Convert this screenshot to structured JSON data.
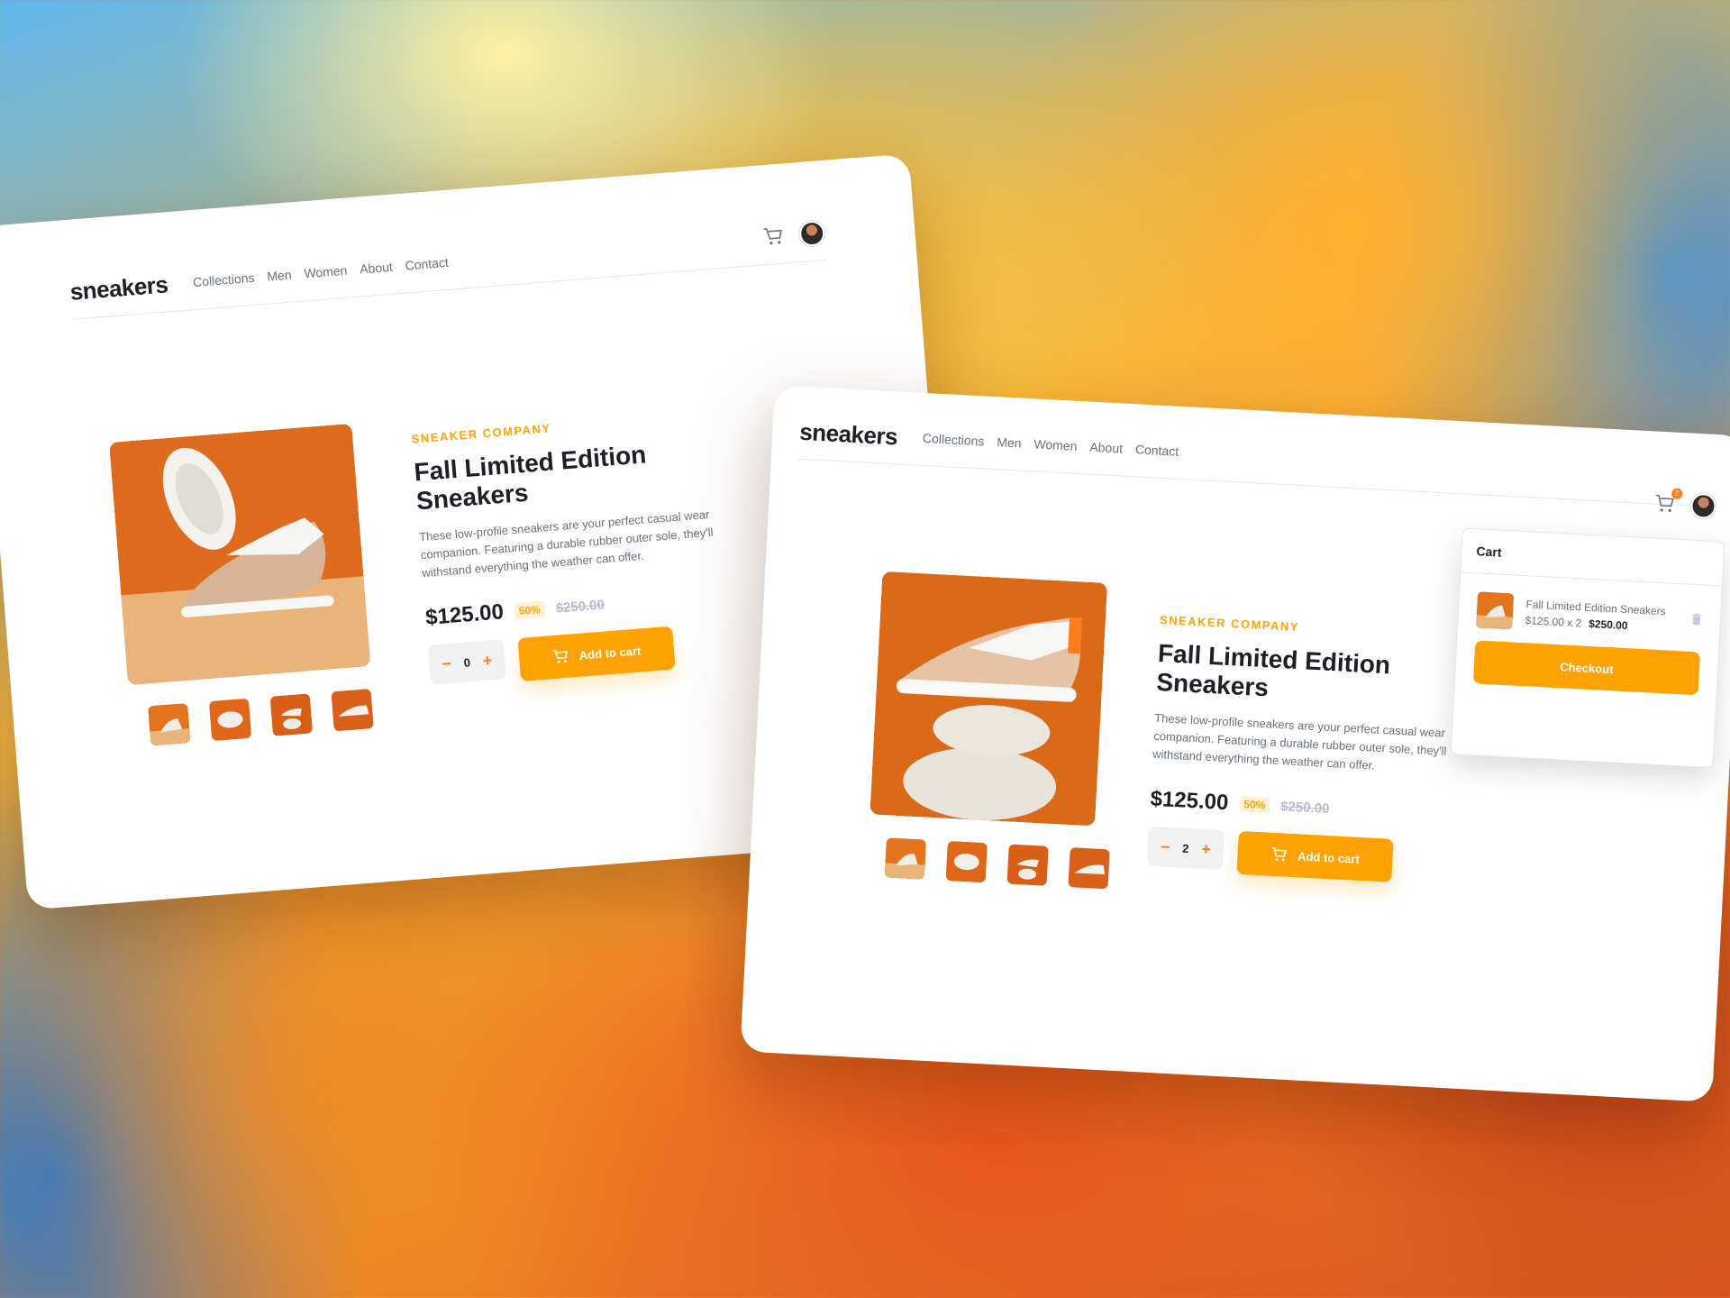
{
  "nav": {
    "logo": "sneakers",
    "links": [
      "Collections",
      "Men",
      "Women",
      "About",
      "Contact"
    ]
  },
  "product": {
    "company": "SNEAKER COMPANY",
    "title": "Fall Limited Edition Sneakers",
    "description": "These low-profile sneakers are your perfect casual wear companion. Featuring a durable rubber outer sole, they'll withstand everything the weather can offer.",
    "price": "$125.00",
    "discount": "50%",
    "old_price": "$250.00",
    "add_to_cart": "Add to cart"
  },
  "window1": {
    "quantity": "0"
  },
  "window2": {
    "quantity": "2",
    "cart_badge": "2"
  },
  "cart": {
    "title": "Cart",
    "item_name": "Fall Limited Edition Sneakers",
    "item_unit": "$125.00 x 2",
    "item_total": "$250.00",
    "checkout": "Checkout"
  },
  "colors": {
    "accent": "#ffa203",
    "orange": "#ff7e1b",
    "dark": "#1d2026",
    "gray": "#69707d"
  },
  "icons": [
    "cart-icon",
    "avatar",
    "minus-icon",
    "plus-icon",
    "trash-icon"
  ]
}
